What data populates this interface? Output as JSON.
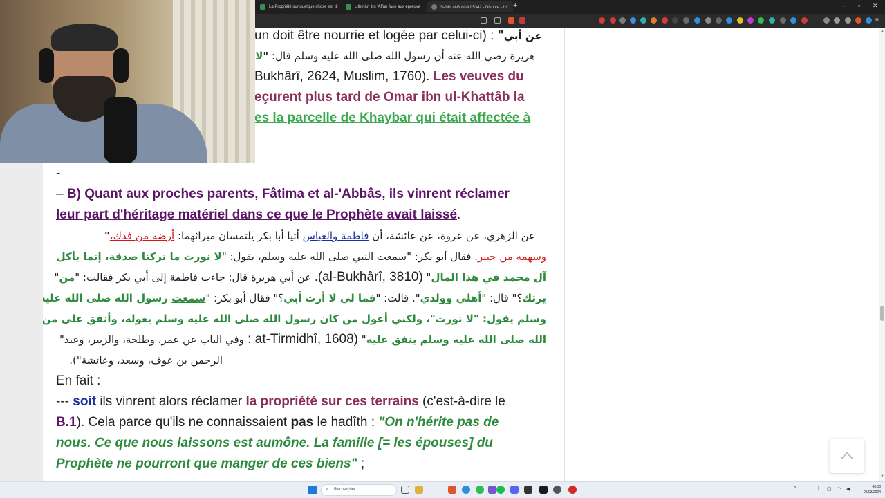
{
  "browser": {
    "tabs": [
      {
        "label": "La Propriété sur quelque chose est di",
        "favicon": "green-doc-icon"
      },
      {
        "label": "Uthmân ibn 'Affân face aux épreuve",
        "favicon": "green-doc-icon"
      },
      {
        "label": "Sahîh al-Bukhârî 5342 - Divorce - كتا",
        "favicon": "globe-icon"
      }
    ],
    "new_tab": "+",
    "window_controls": {
      "minimize": "–",
      "maximize": "▫",
      "close": "✕"
    }
  },
  "article": {
    "top_lines": {
      "l1_fr": "un doit être nourrie et logée par celui-ci) : ",
      "l1_quote": "\"",
      "l1_ar": "عن أبي",
      "l2_ar": "هريرة رضي الله عنه أن رسول الله صلى الله عليه وسلم قال: ",
      "l2_quote": "\"",
      "l2_red": "لا",
      "l3_ref": "Bukhârî, 2624, Muslim, 1760). ",
      "l3_maroon": "Les veuves du",
      "l4_maroon": "eçurent plus tard de Omar ibn ul-Khattâb la",
      "l5_green": "es la parcelle de Khaybar qui était affectée à"
    },
    "dash": "-",
    "section_b": {
      "dash": "– ",
      "label": "B)",
      "title_1": " Quant aux proches parents, Fâtima et al-'Abbâs, ils vinrent réclamer",
      "title_2": "leur part d'héritage matériel dans ce que le Prophète avait laissé",
      "period": "."
    },
    "arabic": {
      "a1_start": "عن الزهري، عن عروة، عن عائشة، أن ",
      "a1_link": "فاطمة والعباس",
      "a1_mid": " أتيا أبا بكر يلتمسان ميراثهما: ",
      "a1_red": "أرضه من فدك،",
      "a1_quote": "\"",
      "a2_red": "وسهمه من خيبر",
      "a2_mid": ". فقال أبو بكر: \"",
      "a2_underline": "سمعت النبي",
      "a2_mid2": " صلى الله عليه وسلم، يقول: \"",
      "a2_green": "لا نورث ما تركنا صدقة، إنما يأكل",
      "a3_green": "آل محمد في هذا المال",
      "a3_mid": "\" ",
      "a3_ref": "(al-Bukhârî, 3810)",
      "a3_end": ". ",
      "a4_start": "عن أبي هريرة قال: جاءت فاطمة إلى أبي بكر فقالت: \"",
      "a4_green": "من",
      "a4_end": "\"",
      "a5_green1": "يرثك",
      "a5_mid1": "؟\" قال: \"",
      "a5_green2": "أهلي وولدي",
      "a5_mid2": "\". قالت: \"",
      "a5_green3": "فما لي لا أرث أبي",
      "a5_mid3": "؟\" فقال أبو بكر: \"",
      "a5_underline": "سمعت",
      "a5_green4": " رسول الله صلى الله عليه",
      "a6_green1": "وسلم يقول: \"",
      "a6_green2": "لا نورث",
      "a6_green3": "\"، ولكني أعول من كان رسول الله صلى الله عليه وسلم يعوله، وأنفق على من كان رسول",
      "a7_green": "الله صلى الله عليه وسلم ينفق عليه",
      "a7_mid": "\" ",
      "a7_ref": "(at-Tirmidhî, 1608 : ",
      "a7_end": "وفي الباب عن عمر، وطلحة، والزبير، وعبد\"",
      "a8": "الرحمن بن عوف، وسعد، وعائشة\").",
      "a8_end": ""
    },
    "en_fait": "En fait :",
    "soit_line": {
      "prefix": "--- ",
      "soit": "soit",
      "mid": " ils vinrent alors réclamer ",
      "maroon": "la propriété sur ces terrains",
      "end": " (c'est-à-dire le"
    },
    "b1_line": {
      "b1": "B.1",
      "mid": "). Cela parce qu'ils ne connaissaient ",
      "pas": "pas",
      "mid2": " le hadîth : ",
      "quote": "\"On n'hérite pas de"
    },
    "quote_2": "nous. Ce que nous laissons est aumône. La famille [= les épouses] du",
    "quote_3_green": "Prophète ne pourront que manger de ces biens\"",
    "quote_3_end": " ;"
  },
  "taskbar": {
    "search_placeholder": "Rechercher",
    "clock_time": "00:00",
    "clock_date": "02/03/2024"
  }
}
